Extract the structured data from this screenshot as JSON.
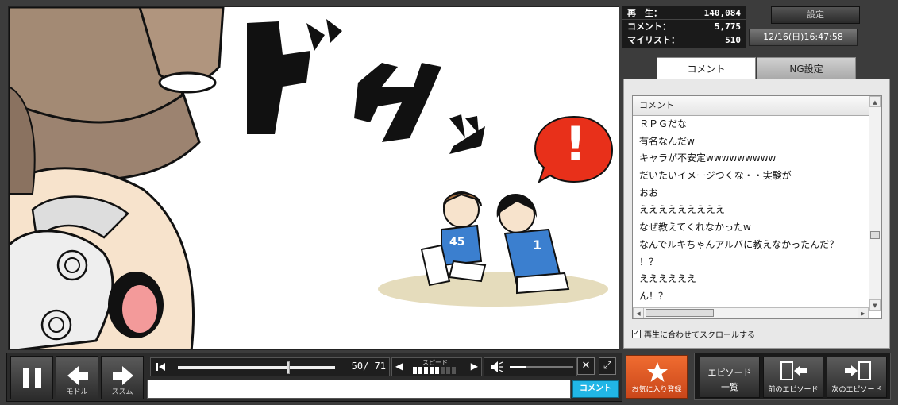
{
  "stats": {
    "views_label": "再　生：",
    "views_value": "140,084",
    "comments_label": "コメント：",
    "comments_value": "5,775",
    "mylist_label": "マイリスト：",
    "mylist_value": "510"
  },
  "settings_label": "設定",
  "datetime": "12/16(日)16:47:58",
  "tabs": {
    "comment": "コメント",
    "ng": "NG設定"
  },
  "comment_list": {
    "header": "コメント",
    "rows": [
      "ＲＰＧだな",
      "有名なんだw",
      "キャラが不安定wwwwwwwww",
      "だいたいイメージつくな・・実験が",
      "おお",
      "えええええええええ",
      "なぜ教えてくれなかったw",
      "なんでルキちゃんアルバに教えなかったんだ？",
      "！？",
      "ええええええ",
      "ん！？"
    ]
  },
  "autoscroll_label": "再生に合わせてスクロールする",
  "manga": {
    "sfx1": "ド",
    "sfx2": "サ",
    "sfx3": "ッ",
    "exclaim": "!",
    "jersey_left": "45",
    "jersey_right": "1"
  },
  "controls": {
    "back_label": "モドル",
    "forward_label": "ススム",
    "page_counter": "50/ 71",
    "speed_label": "スピード",
    "post_label": "コメント"
  },
  "fav_label": "お気に入り登録",
  "episodes": {
    "list_line1": "エピソード",
    "list_line2": "一覧",
    "prev_label": "前のエピソード",
    "next_label": "次のエピソード"
  },
  "progress": {
    "current": 50,
    "total": 71
  },
  "colors": {
    "fav": "#e25a25",
    "post": "#21b6e6",
    "exclaim_bubble": "#e8301a",
    "jersey": "#3b7fcf"
  }
}
